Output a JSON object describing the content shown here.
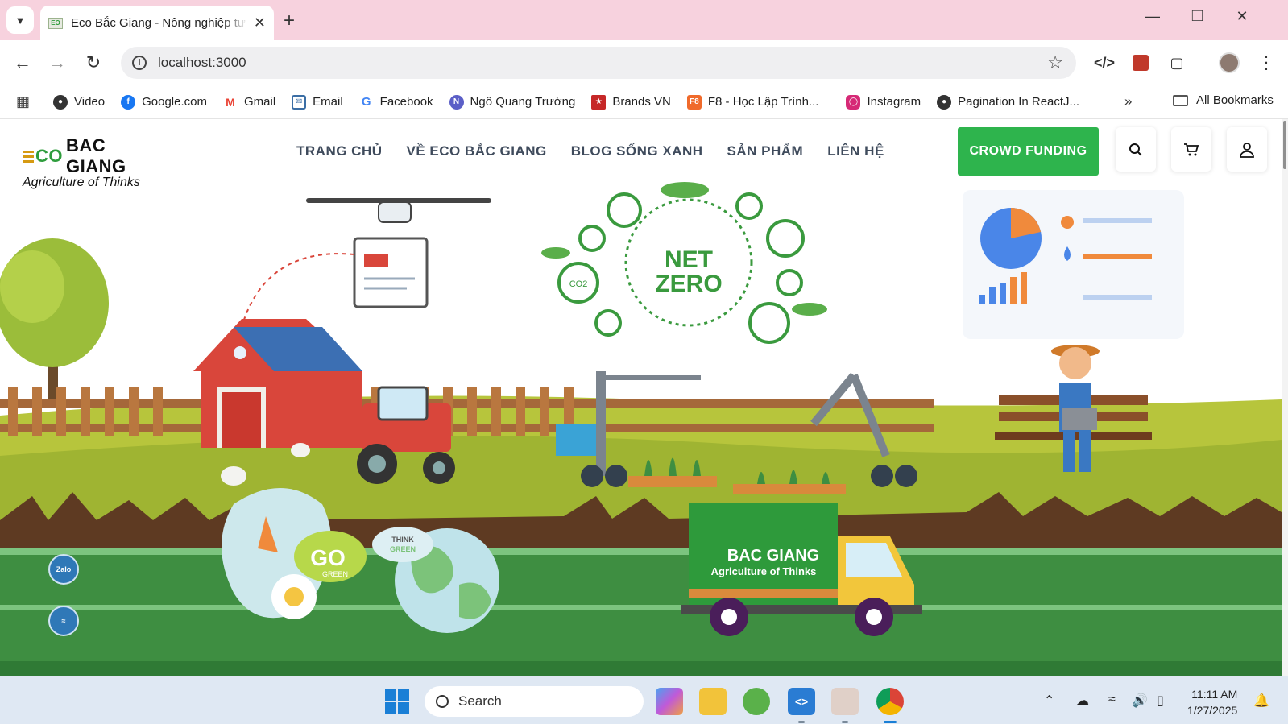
{
  "browser": {
    "tab_title": "Eco Bắc Giang - Nông nghiệp tư",
    "url": "localhost:3000",
    "bookmarks": [
      {
        "label": "Video",
        "color": "#333333"
      },
      {
        "label": "Google.com",
        "color": "#1877f2"
      },
      {
        "label": "Gmail",
        "color": "#ea4335"
      },
      {
        "label": "Email",
        "color": "#3b6ea5"
      },
      {
        "label": "Facebook",
        "color": "#4285f4"
      },
      {
        "label": "Ngô Quang Trường",
        "color": "#5b5fc7"
      },
      {
        "label": "Brands VN",
        "color": "#c62828"
      },
      {
        "label": "F8 - Học Lập Trình...",
        "color": "#f06a2b"
      },
      {
        "label": "Instagram",
        "color": "#d62976"
      },
      {
        "label": "Pagination In ReactJ...",
        "color": "#333333"
      }
    ],
    "all_bookmarks_label": "All Bookmarks"
  },
  "site": {
    "logo_main": "BAC GIANG",
    "logo_tagline": "Agriculture of Thinks",
    "nav": [
      "TRANG CHỦ",
      "VỀ ECO BẮC GIANG",
      "BLOG SỐNG XANH",
      "SẢN PHẨM",
      "LIÊN HỆ"
    ],
    "cta_label": "CROWD FUNDING",
    "accent_color": "#2eb44d",
    "hero": {
      "net_zero_line1": "NET",
      "net_zero_line2": "ZERO",
      "go_green_big": "GO",
      "go_green_small": "GREEN",
      "think_green_1": "THINK",
      "think_green_2": "GREEN",
      "truck_logo": "BAC GIANG",
      "truck_tagline": "Agriculture of Thinks",
      "co2_label": "CO2"
    },
    "float_zalo_label": "Zalo"
  },
  "taskbar": {
    "search_placeholder": "Search",
    "time": "11:11 AM",
    "date": "1/27/2025"
  }
}
